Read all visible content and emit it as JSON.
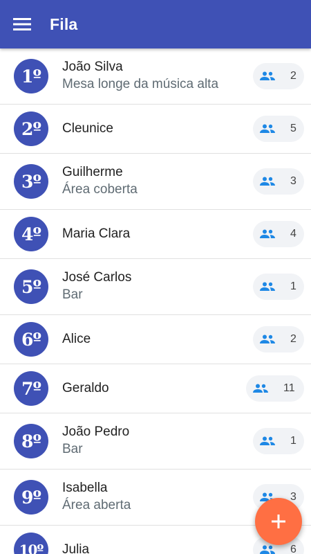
{
  "appbar": {
    "title": "Fila",
    "menu_icon": "menu-icon",
    "color": "#3f51b5"
  },
  "queue": [
    {
      "position": "1º",
      "name": "João Silva",
      "note": "Mesa longe da música alta",
      "party_size": "2"
    },
    {
      "position": "2º",
      "name": "Cleunice",
      "note": "",
      "party_size": "5"
    },
    {
      "position": "3º",
      "name": "Guilherme",
      "note": "Área coberta",
      "party_size": "3"
    },
    {
      "position": "4º",
      "name": "Maria Clara",
      "note": "",
      "party_size": "4"
    },
    {
      "position": "5º",
      "name": "José Carlos",
      "note": "Bar",
      "party_size": "1"
    },
    {
      "position": "6º",
      "name": "Alice",
      "note": "",
      "party_size": "2"
    },
    {
      "position": "7º",
      "name": "Geraldo",
      "note": "",
      "party_size": "11"
    },
    {
      "position": "8º",
      "name": "João Pedro",
      "note": "Bar",
      "party_size": "1"
    },
    {
      "position": "9º",
      "name": "Isabella",
      "note": "Área aberta",
      "party_size": "3"
    },
    {
      "position": "10º",
      "name": "Julia",
      "note": "",
      "party_size": "6"
    }
  ],
  "fab": {
    "icon": "add-icon",
    "color": "#ff6f43"
  },
  "people_icon": "people-icon",
  "people_icon_color": "#1e88e5"
}
